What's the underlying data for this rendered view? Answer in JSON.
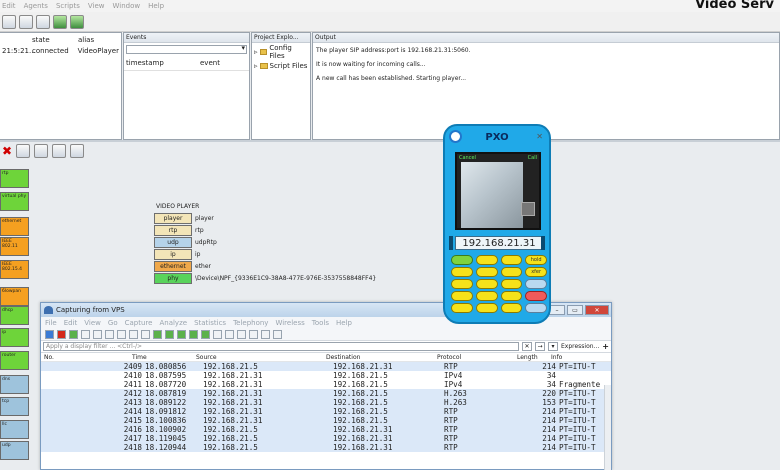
{
  "app": {
    "title": "Video Serv",
    "menu": [
      "Edit",
      "Agents",
      "Scripts",
      "View",
      "Window",
      "Help"
    ]
  },
  "agents": {
    "columns": [
      "state",
      "alias"
    ],
    "rows": [
      {
        "time": "21:5:21...",
        "state": "connected",
        "alias": "VideoPlayer"
      }
    ]
  },
  "events": {
    "title": "Events",
    "columns": [
      "timestamp",
      "event"
    ]
  },
  "project": {
    "title": "Project Explo...",
    "items": [
      "Config Files",
      "Script Files"
    ]
  },
  "output": {
    "title": "Output",
    "lines": [
      "The player SIP address:port is 192.168.21.31:5060.",
      "It is now waiting for incoming calls...",
      "A new call has been established. Starting player..."
    ]
  },
  "palette": [
    {
      "label": "rtp",
      "color": "green"
    },
    {
      "label": "virtual phy",
      "color": "green"
    },
    {
      "label": "ethernet",
      "color": "orange"
    },
    {
      "label": "IEEE 802.11",
      "color": "orange"
    },
    {
      "label": "IEEE 802.15.4",
      "color": "orange"
    },
    {
      "label": "6lowpan",
      "color": "orange"
    },
    {
      "label": "dhcp",
      "color": "green"
    },
    {
      "label": "ip",
      "color": "green"
    },
    {
      "label": "router",
      "color": "green"
    },
    {
      "label": "dns",
      "color": "blue"
    },
    {
      "label": "tcp",
      "color": "blue"
    },
    {
      "label": "llc",
      "color": "blue"
    },
    {
      "label": "udp",
      "color": "blue"
    }
  ],
  "video_player": {
    "title": "VIDEO PLAYER",
    "rows": [
      {
        "name": "player",
        "value": "player",
        "color": "tan"
      },
      {
        "name": "rtp",
        "value": "rtp",
        "color": "tan"
      },
      {
        "name": "udp",
        "value": "udpRtp",
        "color": "blue"
      },
      {
        "name": "ip",
        "value": "ip",
        "color": "tan"
      },
      {
        "name": "ethernet",
        "value": "ether",
        "color": "orange"
      },
      {
        "name": "phy",
        "value": "\\Device\\NPF_{9336E1C9-38A8-477E-976E-3537558848FF4}",
        "color": "green"
      }
    ]
  },
  "wireshark": {
    "title": "Capturing from VPS",
    "menu": [
      "File",
      "Edit",
      "View",
      "Go",
      "Capture",
      "Analyze",
      "Statistics",
      "Telephony",
      "Wireless",
      "Tools",
      "Help"
    ],
    "filter_placeholder": "Apply a display filter ... <Ctrl-/>",
    "expression_label": "Expression...",
    "columns": [
      "No.",
      "Time",
      "Source",
      "Destination",
      "Protocol",
      "Length",
      "Info"
    ],
    "packets": [
      {
        "no": "2409",
        "time": "18.080856",
        "src": "192.168.21.5",
        "dst": "192.168.21.31",
        "proto": "RTP",
        "len": "214",
        "info": "PT=ITU-T",
        "color": "blue"
      },
      {
        "no": "2410",
        "time": "18.087595",
        "src": "192.168.21.31",
        "dst": "192.168.21.5",
        "proto": "IPv4",
        "len": "34",
        "info": "",
        "color": "white"
      },
      {
        "no": "2411",
        "time": "18.087720",
        "src": "192.168.21.31",
        "dst": "192.168.21.5",
        "proto": "IPv4",
        "len": "34",
        "info": "Fragmente",
        "color": "white"
      },
      {
        "no": "2412",
        "time": "18.087819",
        "src": "192.168.21.31",
        "dst": "192.168.21.5",
        "proto": "H.263",
        "len": "220",
        "info": "PT=ITU-T",
        "color": "blue"
      },
      {
        "no": "2413",
        "time": "18.089122",
        "src": "192.168.21.31",
        "dst": "192.168.21.5",
        "proto": "H.263",
        "len": "153",
        "info": "PT=ITU-T",
        "color": "blue"
      },
      {
        "no": "2414",
        "time": "18.091812",
        "src": "192.168.21.31",
        "dst": "192.168.21.5",
        "proto": "RTP",
        "len": "214",
        "info": "PT=ITU-T",
        "color": "blue"
      },
      {
        "no": "2415",
        "time": "18.100836",
        "src": "192.168.21.31",
        "dst": "192.168.21.5",
        "proto": "RTP",
        "len": "214",
        "info": "PT=ITU-T",
        "color": "blue"
      },
      {
        "no": "2416",
        "time": "18.100902",
        "src": "192.168.21.5",
        "dst": "192.168.21.31",
        "proto": "RTP",
        "len": "214",
        "info": "PT=ITU-T",
        "color": "blue"
      },
      {
        "no": "2417",
        "time": "18.119045",
        "src": "192.168.21.5",
        "dst": "192.168.21.31",
        "proto": "RTP",
        "len": "214",
        "info": "PT=ITU-T",
        "color": "blue"
      },
      {
        "no": "2418",
        "time": "18.120944",
        "src": "192.168.21.5",
        "dst": "192.168.21.31",
        "proto": "RTP",
        "len": "214",
        "info": "PT=ITU-T",
        "color": "blue"
      }
    ]
  },
  "phone": {
    "brand": "PXO",
    "ip": "192.168.21.31",
    "screen_left": "Cancel",
    "screen_right": "Call",
    "keys": [
      "",
      "",
      "",
      "hold",
      "",
      "",
      "",
      "xfer",
      "",
      "",
      "",
      "",
      "",
      "",
      "",
      "",
      "",
      "",
      "",
      ""
    ]
  }
}
